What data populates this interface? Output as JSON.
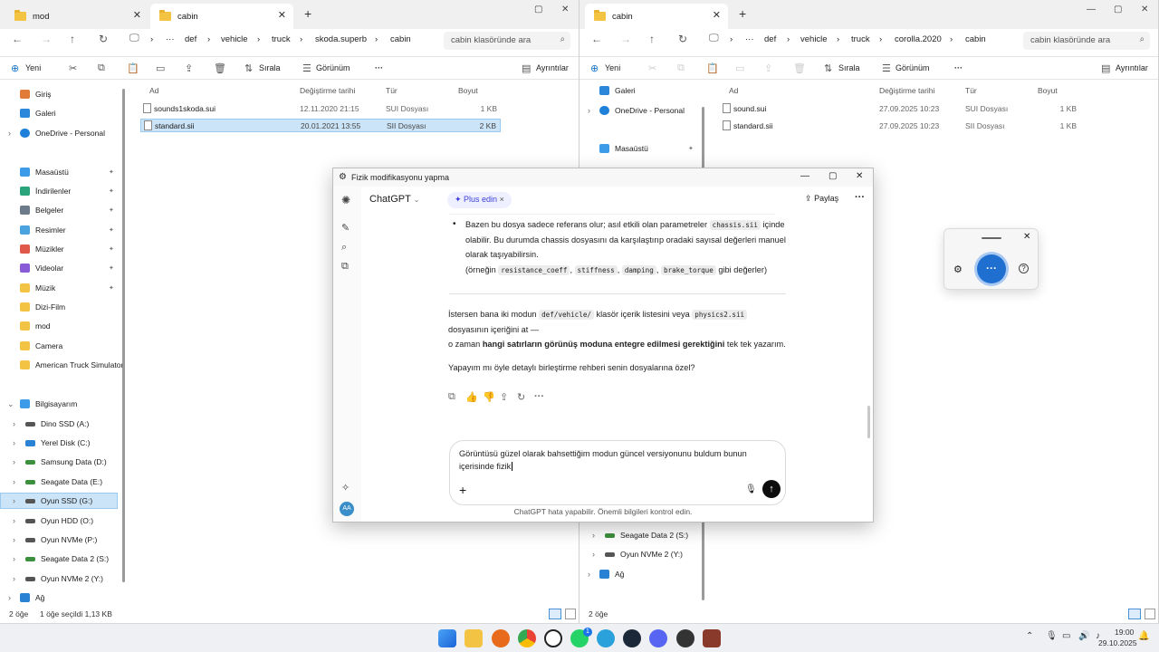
{
  "left_explorer": {
    "tabs": [
      {
        "label": "mod"
      },
      {
        "label": "cabin"
      }
    ],
    "breadcrumb": [
      "def",
      "vehicle",
      "truck",
      "skoda.superb",
      "cabin"
    ],
    "search_placeholder": "cabin klasöründe ara",
    "commands": {
      "new": "Yeni",
      "sort": "Sırala",
      "view": "Görünüm",
      "details": "Ayrıntılar"
    },
    "nav": [
      {
        "label": "Giriş"
      },
      {
        "label": "Galeri"
      },
      {
        "label": "OneDrive - Personal"
      },
      {
        "label": "Masaüstü"
      },
      {
        "label": "İndirilenler"
      },
      {
        "label": "Belgeler"
      },
      {
        "label": "Resimler"
      },
      {
        "label": "Müzikler"
      },
      {
        "label": "Videolar"
      },
      {
        "label": "Müzik"
      },
      {
        "label": "Dizi-Film"
      },
      {
        "label": "mod"
      },
      {
        "label": "Camera"
      },
      {
        "label": "American Truck Simulator"
      },
      {
        "label": "Bilgisayarım"
      },
      {
        "label": "Dino SSD (A:)"
      },
      {
        "label": "Yerel Disk (C:)"
      },
      {
        "label": "Samsung Data (D:)"
      },
      {
        "label": "Seagate Data (E:)"
      },
      {
        "label": "Oyun SSD (G:)"
      },
      {
        "label": "Oyun HDD (O:)"
      },
      {
        "label": "Oyun NVMe (P:)"
      },
      {
        "label": "Seagate Data 2 (S:)"
      },
      {
        "label": "Oyun NVMe 2 (Y:)"
      },
      {
        "label": "Ağ"
      }
    ],
    "columns": [
      "Ad",
      "Değiştirme tarihi",
      "Tür",
      "Boyut"
    ],
    "files": [
      {
        "name": "sounds1skoda.sui",
        "date": "12.11.2020 21:15",
        "type": "SUI Dosyası",
        "size": "1 KB"
      },
      {
        "name": "standard.sii",
        "date": "20.01.2021 13:55",
        "type": "SII Dosyası",
        "size": "2 KB"
      }
    ],
    "status": {
      "count": "2 öğe",
      "selected": "1 öğe seçildi  1,13 KB"
    }
  },
  "right_explorer": {
    "tabs": [
      {
        "label": "cabin"
      }
    ],
    "breadcrumb": [
      "def",
      "vehicle",
      "truck",
      "corolla.2020",
      "cabin"
    ],
    "search_placeholder": "cabin klasöründe ara",
    "commands": {
      "new": "Yeni",
      "sort": "Sırala",
      "view": "Görünüm",
      "details": "Ayrıntılar"
    },
    "nav": [
      {
        "label": "Galeri"
      },
      {
        "label": "OneDrive - Personal"
      },
      {
        "label": "Masaüstü"
      },
      {
        "label": "Seagate Data 2 (S:)"
      },
      {
        "label": "Oyun NVMe 2 (Y:)"
      },
      {
        "label": "Ağ"
      }
    ],
    "columns": [
      "Ad",
      "Değiştirme tarihi",
      "Tür",
      "Boyut"
    ],
    "files": [
      {
        "name": "sound.sui",
        "date": "27.09.2025 10:23",
        "type": "SUI Dosyası",
        "size": "1 KB"
      },
      {
        "name": "standard.sii",
        "date": "27.09.2025 10:23",
        "type": "SII Dosyası",
        "size": "1 KB"
      }
    ],
    "status": {
      "count": "2 öğe"
    }
  },
  "chat": {
    "window_title": "Fizik modifikasyonu yapma",
    "model": "ChatGPT",
    "plus": "✦ Plus edin",
    "share": "Paylaş",
    "bullet": {
      "t1": "Bazen bu dosya sadece referans olur; asıl etkili olan parametreler",
      "c1": "chassis.sii",
      "t2": "içinde",
      "l2": "olabilir. Bu durumda chassis dosyasını da karşılaştırıp oradaki sayısal değerleri manuel",
      "l3": "olarak taşıyabilirsin.",
      "ex_pre": "(örneğin",
      "ex": [
        "resistance_coeff",
        "stiffness",
        "damping",
        "brake_torque"
      ],
      "ex_post": "gibi değerler)"
    },
    "para1": {
      "t1": "İstersen bana iki modun",
      "c1": "def/vehicle/",
      "t2": "klasör içerik listesini veya",
      "c2": "physics2.sii",
      "l2": "dosyasının içeriğini at —",
      "l3a": "o zaman",
      "l3b": "hangi satırların görünüş moduna entegre edilmesi gerektiğini",
      "l3c": "tek tek yazarım."
    },
    "para2": "Yapayım mı öyle detaylı birleştirme rehberi senin dosyalarına özel?",
    "input_line1": "Görüntüsü güzel olarak bahsettiğim modun güncel versiyonunu buldum bunun",
    "input_line2": "içerisinde fizik",
    "avatar": "AA",
    "disclaimer": "ChatGPT hata yapabilir. Önemli bilgileri kontrol edin."
  },
  "tray": {
    "time": "19:00",
    "date": "29.10.2025",
    "badge": "1"
  }
}
